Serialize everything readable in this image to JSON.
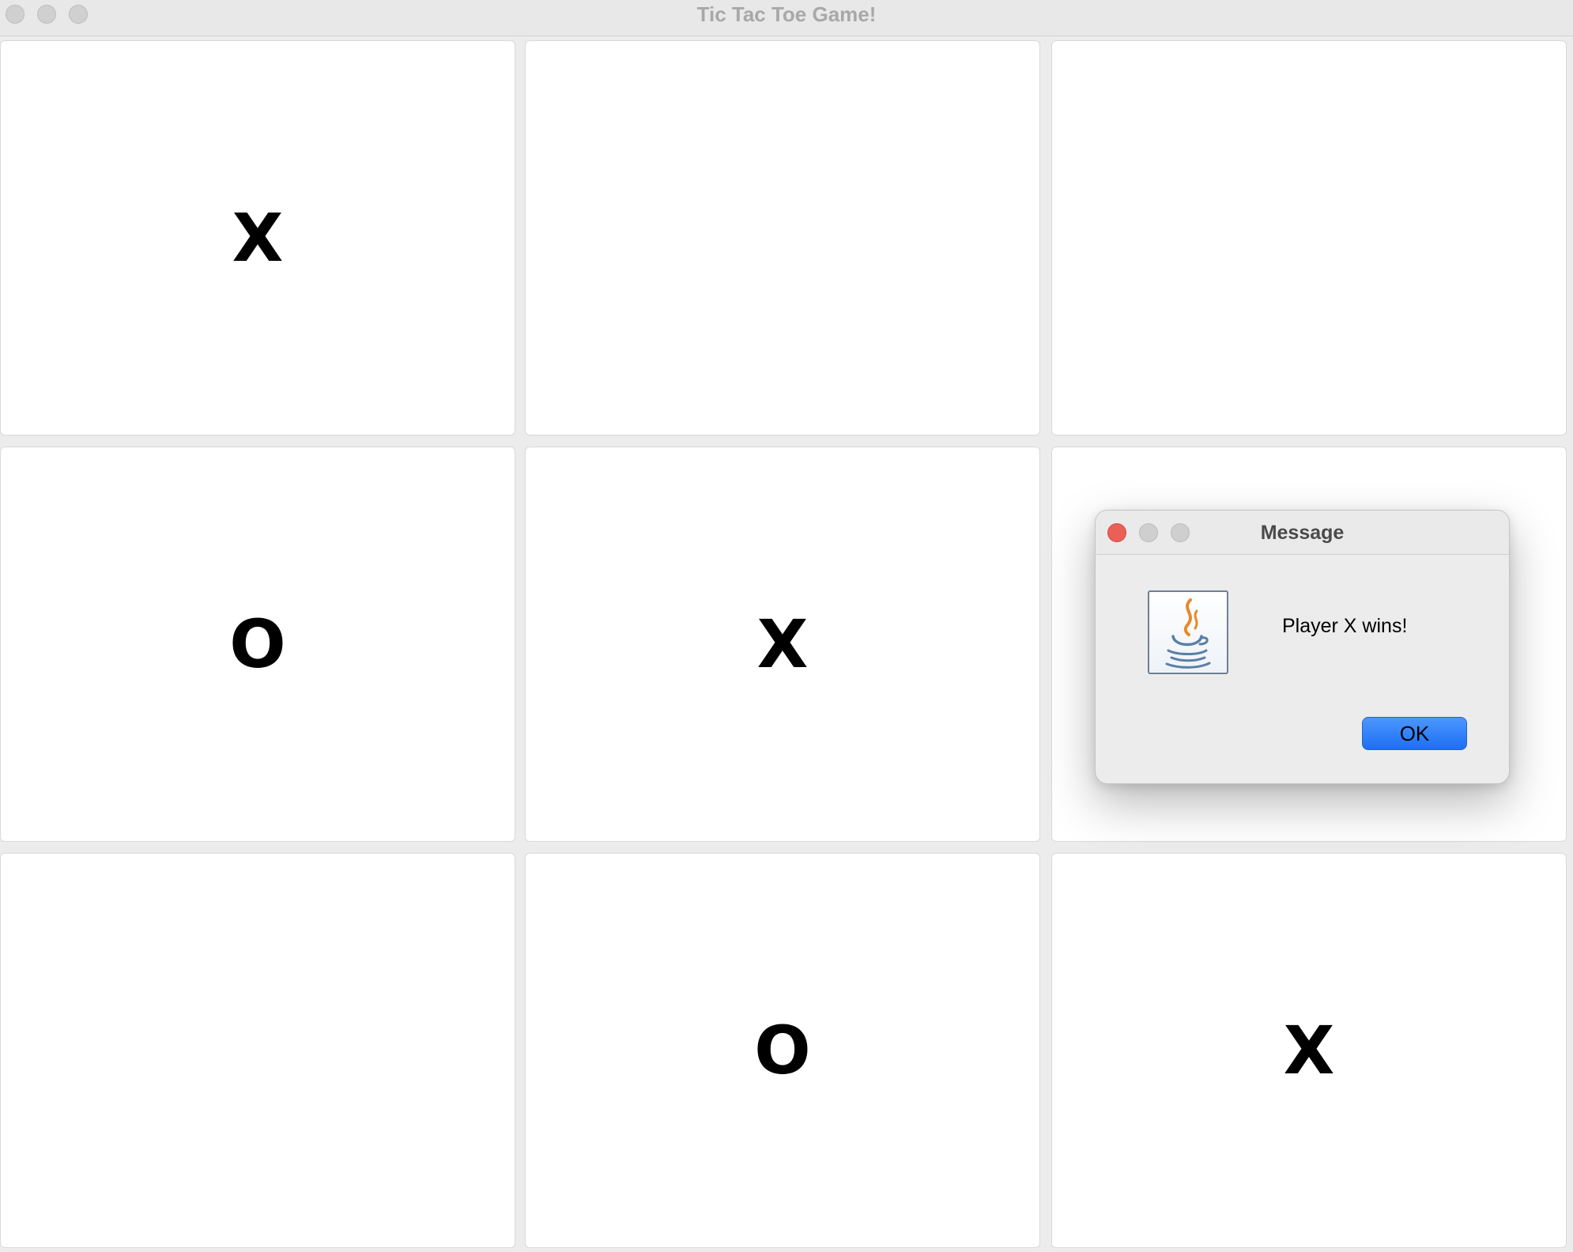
{
  "window": {
    "title": "Tic Tac Toe Game!"
  },
  "board": {
    "cells": [
      [
        "X",
        "",
        ""
      ],
      [
        "O",
        "X",
        ""
      ],
      [
        "",
        "O",
        "X"
      ]
    ]
  },
  "dialog": {
    "title": "Message",
    "icon": "java-icon",
    "message": "Player X wins!",
    "ok_label": "OK"
  },
  "colors": {
    "ok_button": "#2f7bf6",
    "close_button": "#ec5f57"
  }
}
